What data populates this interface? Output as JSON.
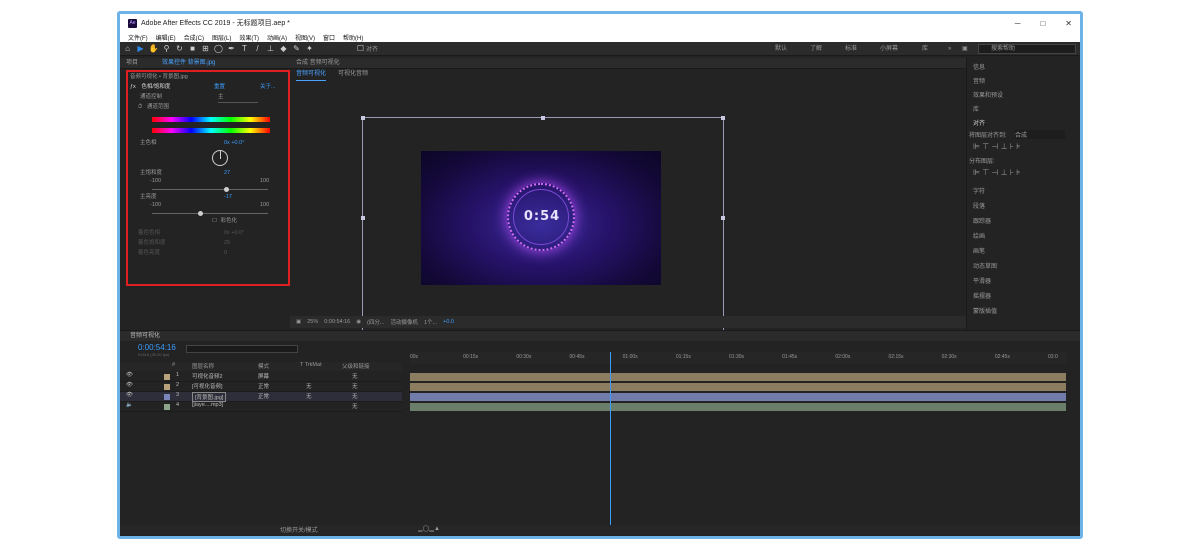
{
  "app": {
    "logo_text": "Ae",
    "title": "Adobe After Effects CC 2019 - 无标题项目.aep *",
    "win_controls": [
      "─",
      "□",
      "✕"
    ]
  },
  "menu": [
    "文件(F)",
    "编辑(E)",
    "合成(C)",
    "图层(L)",
    "效果(T)",
    "动画(A)",
    "视图(V)",
    "窗口",
    "帮助(H)"
  ],
  "toolbar": {
    "tools": [
      "home-icon",
      "selection-icon",
      "hand-icon",
      "zoom-icon",
      "rotate-icon",
      "camera-icon",
      "pan-behind-icon",
      "mask-icon",
      "pen-icon",
      "type-icon",
      "brush-icon",
      "clone-stamp-icon",
      "eraser-icon",
      "roto-brush-icon",
      "puppet-icon"
    ],
    "snap_label": "对齐",
    "workspaces": [
      "默认",
      "了解",
      "标准",
      "小屏幕",
      "库"
    ],
    "search_placeholder": "搜索帮助"
  },
  "project_panel": {
    "tabs": [
      "项目",
      "效果控件 背景图.jpg"
    ],
    "breadcrumb": "音频可视化 • 背景图.jpg",
    "fx": {
      "name": "色相/饱和度",
      "reset": "重置",
      "about": "关于...",
      "channel_label": "通道控制",
      "channel_value": "主",
      "range_label": "通道范围",
      "hue_label": "主色相",
      "hue_value": "0x +0.0°",
      "saturation_label": "主饱和度",
      "saturation_value": "27",
      "saturation_level": 0.635,
      "lightness_label": "主亮度",
      "lightness_value": "-17",
      "lightness_level": 0.415,
      "min": "-100",
      "max": "100",
      "colorize_label": "彩色化",
      "colorize_hue_label": "着色色相",
      "colorize_hue_value": "0x +0.0°",
      "colorize_sat_label": "着色饱和度",
      "colorize_sat_value": "25",
      "colorize_light_label": "着色亮度",
      "colorize_light_value": "0"
    }
  },
  "composition": {
    "tab": "合成 音频可视化",
    "subtabs": [
      "音频可视化",
      "可视化音频"
    ],
    "video_text": "0:54",
    "zoom": "25%",
    "timecode": "0:00:54:16",
    "resolution": "(四分...",
    "camera": "活动摄像机",
    "views": "1个...",
    "exposure": "+0.0"
  },
  "right_panel": {
    "items": [
      "信息",
      "音频",
      "效果和预设",
      "库",
      "对齐"
    ],
    "align_to_label": "将图层对齐到:",
    "align_to_value": "合成",
    "distribute_label": "分布图层:",
    "items2": [
      "字符",
      "段落",
      "跟踪器",
      "绘画",
      "画笔",
      "动态草图",
      "平滑器",
      "摇摆器",
      "蒙版插值"
    ]
  },
  "timeline": {
    "comp_name": "音频可视化",
    "timecode": "0:00:54:16",
    "frame_info": "01616 (30.00 fps)",
    "columns": [
      "#",
      "图层名称",
      "模式",
      "T TrkMat",
      "父级和链接"
    ],
    "layers": [
      {
        "num": "1",
        "name": "可视化音频2",
        "mode": "屏幕",
        "trk": "",
        "parent": "无",
        "color": "#b9a27a"
      },
      {
        "num": "2",
        "name": "[可视化音频]",
        "mode": "正常",
        "trk": "无",
        "parent": "无",
        "color": "#b9a27a"
      },
      {
        "num": "3",
        "name": "[背景图.jpg]",
        "mode": "正常",
        "trk": "无",
        "parent": "无",
        "color": "#7a86b9"
      },
      {
        "num": "4",
        "name": "[jiaye....mp3]",
        "mode": "",
        "trk": "",
        "parent": "无",
        "color": "#8aa58a"
      }
    ],
    "ruler": [
      "00s",
      "00:15s",
      "00:30s",
      "00:45s",
      "01:00s",
      "01:15s",
      "01:30s",
      "01:45s",
      "02:00s",
      "02:15s",
      "02:30s",
      "02:45s",
      "03:0"
    ],
    "footer_label": "切换开关/模式",
    "current_time_fraction": 0.305
  }
}
